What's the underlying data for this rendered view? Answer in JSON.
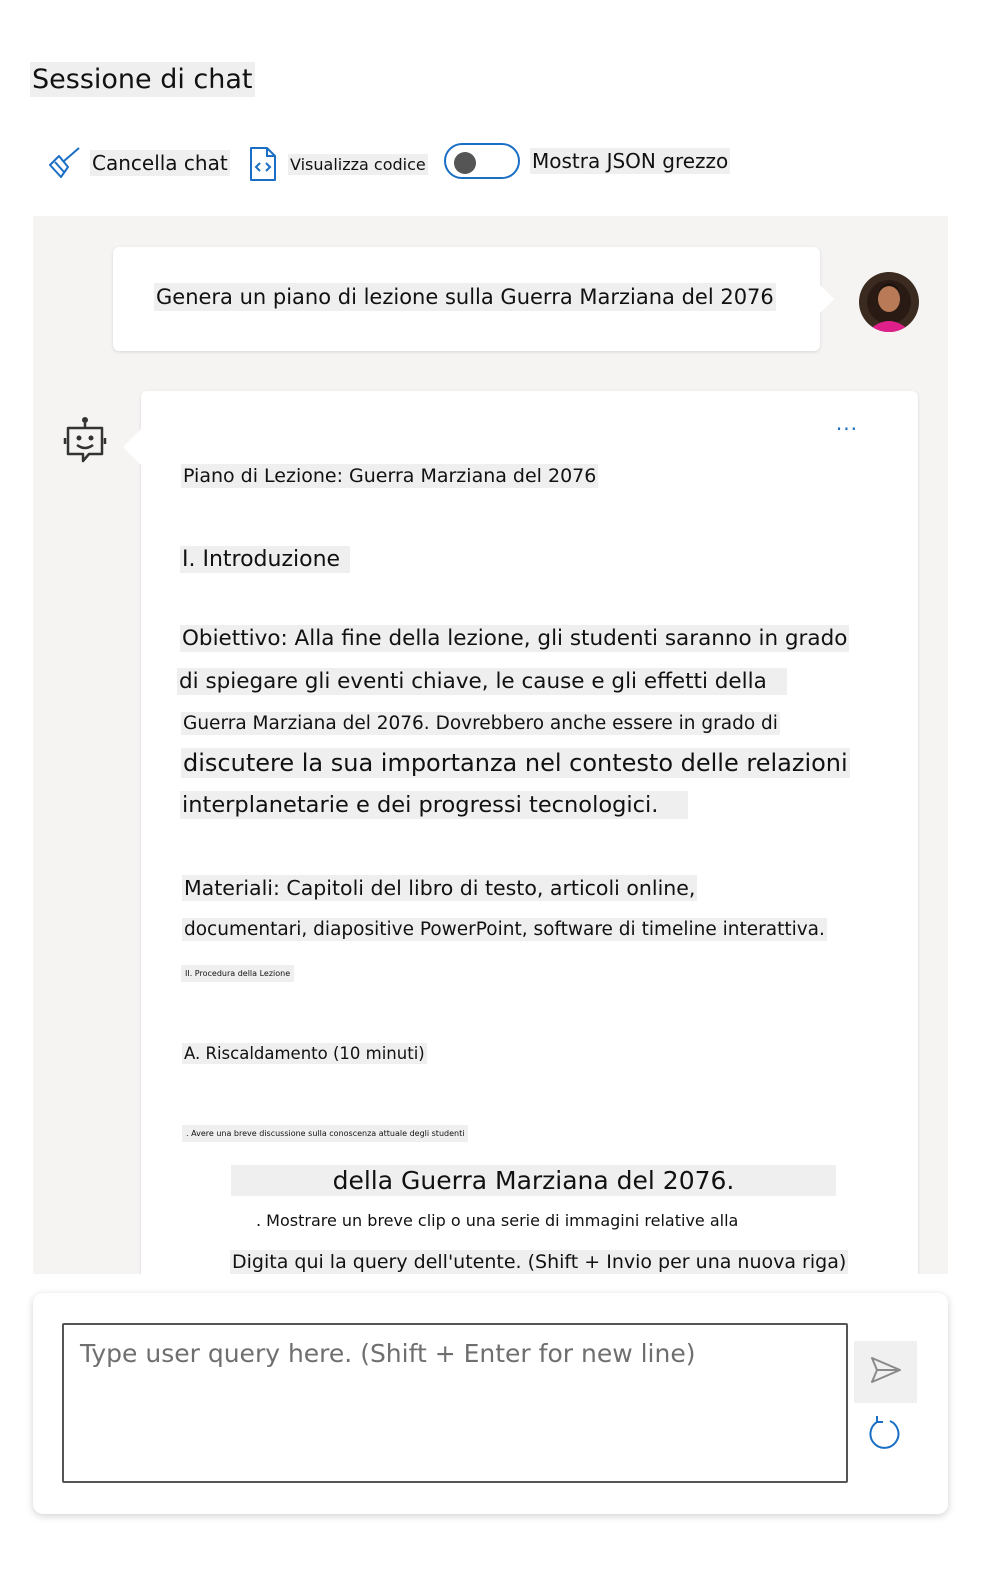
{
  "header": {
    "title": "Sessione di chat"
  },
  "toolbar": {
    "clear_label": "Cancella chat",
    "view_code_label": "Visualizza codice",
    "json_toggle_label": "Mostra JSON grezzo",
    "json_toggle_on": false
  },
  "chat": {
    "user_message": "Genera un piano di lezione sulla Guerra Marziana del 2076",
    "more_label": "···",
    "bot_lines": [
      "Piano di Lezione: Guerra Marziana del 2076",
      "I. Introduzione",
      "Obiettivo: Alla fine della lezione, gli studenti saranno in grado",
      "di spiegare gli eventi chiave, le cause e gli effetti della",
      "Guerra Marziana del 2076. Dovrebbero anche essere in grado di",
      "discutere la sua importanza nel contesto delle relazioni",
      "interplanetarie e dei progressi tecnologici.",
      "Materiali: Capitoli del libro di testo, articoli online,",
      "documentari, diapositive PowerPoint, software di timeline interattiva.",
      "II. Procedura della Lezione",
      "A. Riscaldamento (10 minuti)",
      ". Avere una breve discussione sulla conoscenza attuale degli studenti",
      "della Guerra Marziana del 2076.",
      ". Mostrare un breve clip o una serie di immagini relative alla",
      "Digita qui la query dell'utente. (Shift + Invio per una nuova riga)"
    ]
  },
  "input": {
    "placeholder": "Type user query here. (Shift + Enter for new line)",
    "value": ""
  },
  "colors": {
    "accent": "#1a6fc4",
    "chat_bg": "#f5f4f3"
  }
}
